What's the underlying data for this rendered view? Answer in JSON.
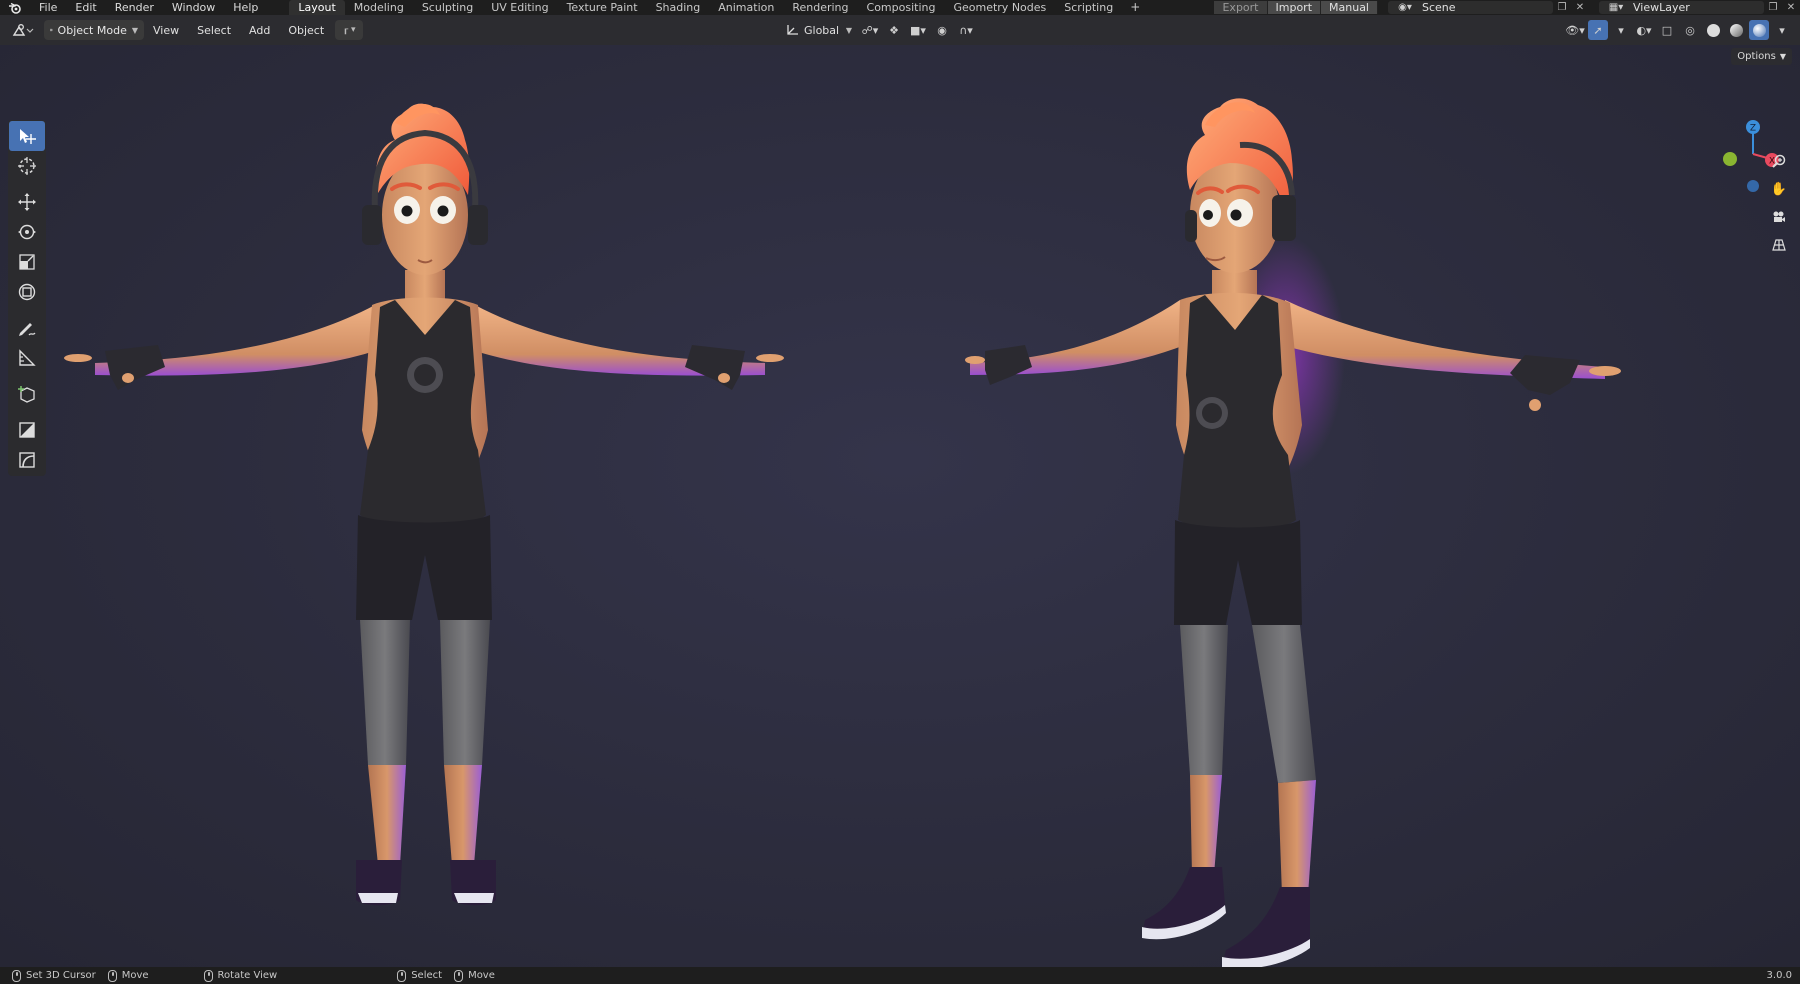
{
  "topbar": {
    "menus": [
      "File",
      "Edit",
      "Render",
      "Window",
      "Help"
    ],
    "workspaces": [
      "Layout",
      "Modeling",
      "Sculpting",
      "UV Editing",
      "Texture Paint",
      "Shading",
      "Animation",
      "Rendering",
      "Compositing",
      "Geometry Nodes",
      "Scripting"
    ],
    "active_workspace": "Layout",
    "export_label": "Export",
    "import_label": "Import",
    "manual_label": "Manual",
    "scene": "Scene",
    "view_layer": "ViewLayer"
  },
  "header": {
    "mode": "Object Mode",
    "menus": [
      "View",
      "Select",
      "Add",
      "Object"
    ],
    "orientation": "Global",
    "options_label": "Options"
  },
  "toolbar": {
    "tools": [
      "select-box",
      "cursor",
      "move",
      "rotate",
      "scale",
      "transform",
      "annotate",
      "measure",
      "add-cube",
      "tool-extra-1",
      "tool-extra-2"
    ],
    "active_tool": "select-box"
  },
  "gizmo": {
    "axes": [
      "Z",
      "X",
      "Y"
    ],
    "colors": {
      "x": "#e84a5f",
      "y": "#8ab531",
      "z": "#3b8fdb"
    }
  },
  "statusbar": {
    "items": [
      "Set 3D Cursor",
      "Move",
      "Rotate View",
      "Select",
      "Move"
    ],
    "version": "3.0.0"
  },
  "colors": {
    "accent": "#4772b3",
    "viewport_bg": "#2c2c3d",
    "skin": "#d99a6c",
    "hair": "#ff7a4f",
    "rim_light": "#c23aff"
  }
}
